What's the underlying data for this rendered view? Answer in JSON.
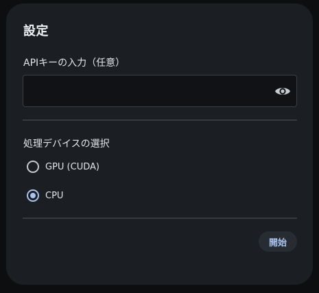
{
  "dialog": {
    "title": "設定"
  },
  "api_key": {
    "label": "APIキーの入力（任意）",
    "value": "",
    "placeholder": "",
    "visibility_icon": "eye-icon"
  },
  "device": {
    "label": "処理デバイスの選択",
    "options": [
      {
        "label": "GPU (CUDA)",
        "selected": false
      },
      {
        "label": "CPU",
        "selected": true
      }
    ]
  },
  "actions": {
    "start_label": "開始"
  },
  "colors": {
    "background": "#0d0e10",
    "dialog": "#1b1f24",
    "accent": "#a9c4f0",
    "input_bg": "#101215",
    "divider": "#373b40",
    "button_bg": "#272c32"
  }
}
